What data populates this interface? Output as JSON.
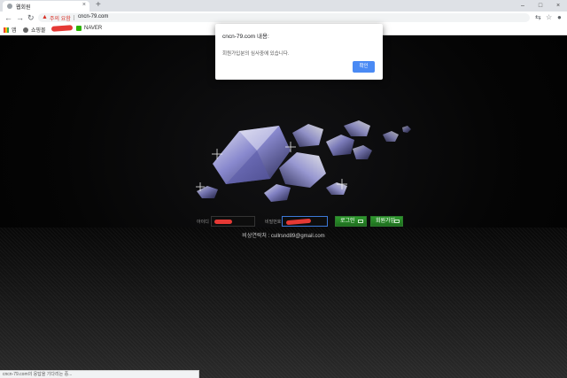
{
  "browser": {
    "tab_title": "웹회원",
    "tab_close": "×",
    "new_tab": "+",
    "window_buttons": [
      "–",
      "□",
      "×"
    ],
    "security_label": "주의 요함",
    "url": "cncn-79.com",
    "bookmarks": [
      {
        "label": "앱",
        "icon": "apps-grid-icon"
      },
      {
        "label": "쇼핑몰",
        "icon": "globe-icon"
      },
      {
        "label": "NAVER",
        "icon": "naver-icon"
      }
    ]
  },
  "dialog": {
    "title": "cncn-79.com 내용:",
    "message": "회원가입분의 심사중에 있습니다.",
    "ok_label": "확인"
  },
  "login": {
    "id_label": "아이디",
    "pw_label": "비밀번호",
    "login_button": "로그인",
    "signup_button": "회원가입",
    "contact": "비상연락처 : cullrsnd89@gmail.com"
  },
  "status_text": "cncn-79.com의 응답을 기다리는 중...",
  "colors": {
    "background": "#000000",
    "button_green": "#2e9a2e",
    "dialog_button": "#4a8af4",
    "warning": "#d93025",
    "redaction": "#e53935"
  }
}
